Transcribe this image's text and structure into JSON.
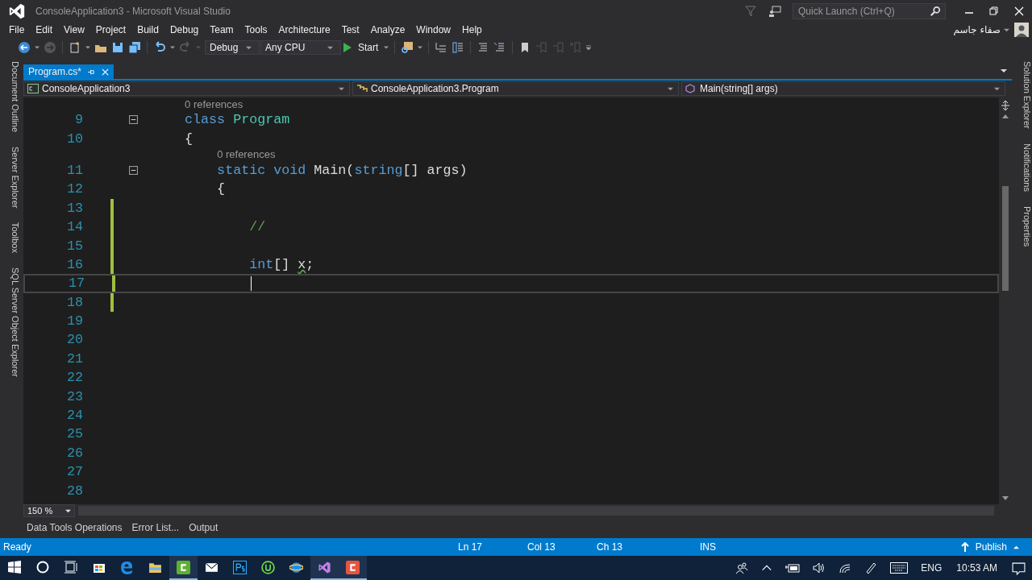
{
  "window": {
    "title": "ConsoleApplication3 - Microsoft Visual Studio"
  },
  "quick_launch": {
    "placeholder": "Quick Launch (Ctrl+Q)"
  },
  "user": {
    "name": "صفاء جاسم"
  },
  "menu": [
    "File",
    "Edit",
    "View",
    "Project",
    "Build",
    "Debug",
    "Team",
    "Tools",
    "Architecture",
    "Test",
    "Analyze",
    "Window",
    "Help"
  ],
  "toolbar": {
    "configuration": "Debug",
    "platform": "Any CPU",
    "start": "Start"
  },
  "left_tabs": [
    "Document Outline",
    "Server Explorer",
    "Toolbox",
    "SQL Server Object Explorer"
  ],
  "right_tabs": [
    "Solution Explorer",
    "Notifications",
    "Properties"
  ],
  "document_tabs": [
    {
      "label": "Program.cs*",
      "selected": true
    }
  ],
  "navigation": [
    "ConsoleApplication3",
    "ConsoleApplication3.Program",
    "Main(string[] args)"
  ],
  "code_lines": [
    {
      "number": "9",
      "lens": "0 references",
      "foldable": true,
      "changed": false,
      "current": false,
      "tokens": [
        {
          "text": "    class",
          "kind": "keyword"
        },
        {
          "text": " Program",
          "kind": "type"
        }
      ]
    },
    {
      "number": "10",
      "foldable": false,
      "changed": false,
      "current": false,
      "tokens": [
        {
          "text": "    {",
          "kind": "plain"
        }
      ]
    },
    {
      "number": "11",
      "lens": "0 references",
      "foldable": true,
      "changed": false,
      "current": false,
      "tokens": [
        {
          "text": "        static",
          "kind": "keyword"
        },
        {
          "text": " void",
          "kind": "keyword"
        },
        {
          "text": " Main(",
          "kind": "plain"
        },
        {
          "text": "string",
          "kind": "keyword"
        },
        {
          "text": "[] args)",
          "kind": "plain"
        }
      ]
    },
    {
      "number": "12",
      "foldable": false,
      "changed": false,
      "current": false,
      "tokens": [
        {
          "text": "        {",
          "kind": "plain"
        }
      ]
    },
    {
      "number": "13",
      "foldable": false,
      "changed": true,
      "current": false
    },
    {
      "number": "14",
      "foldable": false,
      "changed": true,
      "current": false,
      "tokens": [
        {
          "text": "            //",
          "kind": "comment"
        }
      ]
    },
    {
      "number": "15",
      "foldable": false,
      "changed": true,
      "current": false
    },
    {
      "number": "16",
      "foldable": false,
      "changed": true,
      "current": false,
      "tokens": [
        {
          "text": "            int",
          "kind": "keyword"
        },
        {
          "text": "[] ",
          "kind": "plain"
        },
        {
          "text": "x",
          "kind": "warning"
        },
        {
          "text": ";",
          "kind": "plain"
        }
      ]
    },
    {
      "number": "17",
      "foldable": false,
      "changed": true,
      "current": true
    },
    {
      "number": "18",
      "foldable": false,
      "changed": true,
      "current": false
    },
    {
      "number": "19",
      "foldable": false,
      "changed": false,
      "current": false
    },
    {
      "number": "20",
      "foldable": false,
      "changed": false,
      "current": false
    },
    {
      "number": "21",
      "foldable": false,
      "changed": false,
      "current": false
    },
    {
      "number": "22",
      "foldable": false,
      "changed": false,
      "current": false
    },
    {
      "number": "23",
      "foldable": false,
      "changed": false,
      "current": false
    },
    {
      "number": "24",
      "foldable": false,
      "changed": false,
      "current": false
    },
    {
      "number": "25",
      "foldable": false,
      "changed": false,
      "current": false
    },
    {
      "number": "26",
      "foldable": false,
      "changed": false,
      "current": false
    },
    {
      "number": "27",
      "foldable": false,
      "changed": false,
      "current": false
    },
    {
      "number": "28",
      "foldable": false,
      "changed": false,
      "current": false
    }
  ],
  "zoom": "150 %",
  "bottom_tabs": [
    "Data Tools Operations",
    "Error List...",
    "Output"
  ],
  "status_bar": {
    "state": "Ready",
    "line": "Ln 17",
    "column": "Col 13",
    "char": "Ch 13",
    "mode": "INS",
    "publish": "Publish"
  },
  "taskbar": [
    {
      "kind": "start",
      "running": false
    },
    {
      "kind": "cortana",
      "running": false
    },
    {
      "kind": "taskview",
      "running": false
    },
    {
      "kind": "store",
      "running": false
    },
    {
      "kind": "edge",
      "running": false
    },
    {
      "kind": "explorer",
      "running": false
    },
    {
      "kind": "camtasia",
      "running": true
    },
    {
      "kind": "mail",
      "running": false
    },
    {
      "kind": "photoshop",
      "running": false
    },
    {
      "kind": "upwork",
      "running": false
    },
    {
      "kind": "ie",
      "running": false
    },
    {
      "kind": "vs",
      "running": true
    },
    {
      "kind": "recorder",
      "running": true
    }
  ],
  "tray": {
    "language": "ENG",
    "time": "10:53 AM"
  }
}
